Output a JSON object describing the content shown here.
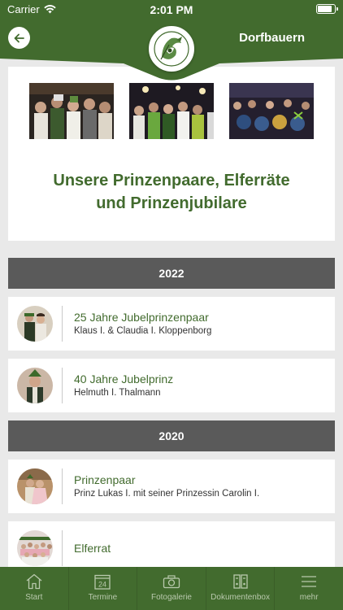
{
  "status_bar": {
    "carrier": "Carrier",
    "time": "2:01 PM",
    "battery_level": 0.9
  },
  "header": {
    "title": "Dorfbauern",
    "back_icon": "arrow-left-icon",
    "logo": "club-logo"
  },
  "intro": {
    "photos": [
      "carnival-group-photo",
      "carnival-party-photo",
      "carnival-hall-photo"
    ],
    "title": "Unsere Prinzenpaare, Elferräte und Prinzenjubilare"
  },
  "sections": [
    {
      "year": "2022",
      "entries": [
        {
          "title": "25 Jahre Jubelprinzenpaar",
          "subtitle": "Klaus I. & Claudia I. Kloppenborg"
        },
        {
          "title": "40 Jahre Jubelprinz",
          "subtitle": "Helmuth I. Thalmann"
        }
      ]
    },
    {
      "year": "2020",
      "entries": [
        {
          "title": "Prinzenpaar",
          "subtitle": "Prinz Lukas I. mit seiner Prinzessin Carolin I."
        },
        {
          "title": "Elferrat",
          "subtitle": ""
        }
      ]
    }
  ],
  "tabbar": {
    "items": [
      {
        "label": "Start",
        "icon": "home-icon"
      },
      {
        "label": "Termine",
        "icon": "calendar-icon",
        "calendar_day": "24"
      },
      {
        "label": "Fotogalerie",
        "icon": "camera-icon"
      },
      {
        "label": "Dokumentenbox",
        "icon": "document-box-icon"
      },
      {
        "label": "mehr",
        "icon": "menu-icon"
      }
    ]
  },
  "colors": {
    "primary": "#426b2e",
    "year_bar": "#5a5a5a",
    "background": "#e9e9e9"
  }
}
